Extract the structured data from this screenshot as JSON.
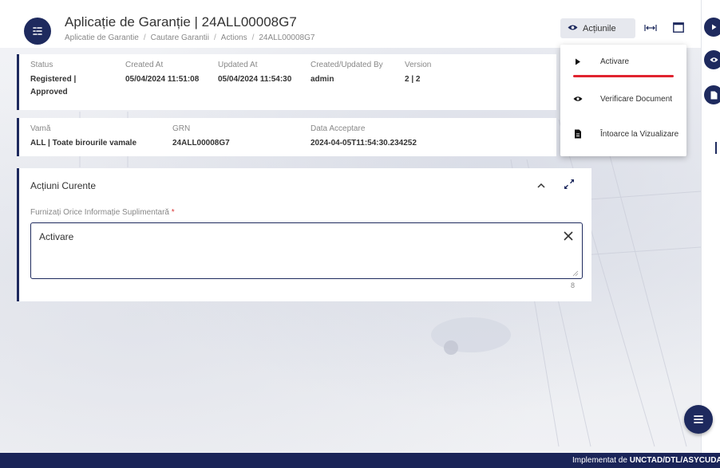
{
  "header": {
    "title": "Aplicație de Garanție | 24ALL00008G7",
    "breadcrumb": [
      "Aplicatie de Garantie",
      "Cautare Garantii",
      "Actions",
      "24ALL00008G7"
    ],
    "actions_label": "Acțiunile"
  },
  "status_card": {
    "fields": [
      {
        "label": "Status",
        "value": "Registered | Approved"
      },
      {
        "label": "Created At",
        "value": "05/04/2024 11:51:08"
      },
      {
        "label": "Updated At",
        "value": "05/04/2024 11:54:30"
      },
      {
        "label": "Created/Updated By",
        "value": "admin"
      },
      {
        "label": "Version",
        "value": "2 | 2"
      }
    ]
  },
  "customs_card": {
    "fields": [
      {
        "label": "Vamă",
        "value": "ALL | Toate birourile vamale"
      },
      {
        "label": "GRN",
        "value": "24ALL00008G7"
      },
      {
        "label": "Data Acceptare",
        "value": "2024-04-05T11:54:30.234252"
      }
    ]
  },
  "actions_card": {
    "title": "Acțiuni Curente",
    "field_label": "Furnizați Orice Informație Suplimentară",
    "required_mark": "*",
    "textarea_value": "Activare",
    "char_count": "8"
  },
  "dropdown": {
    "items": [
      {
        "label": "Activare",
        "icon": "play-icon"
      },
      {
        "label": "Verificare Document",
        "icon": "eye-icon"
      },
      {
        "label": "Întoarce la Vizualizare",
        "icon": "document-icon"
      }
    ]
  },
  "footer": {
    "prefix": "Implementat de",
    "org": "UNCTAD/DTL/ASYCUDA"
  },
  "colors": {
    "primary": "#1e2a5e",
    "accent_red": "#e0232f",
    "required": "#d93636"
  }
}
